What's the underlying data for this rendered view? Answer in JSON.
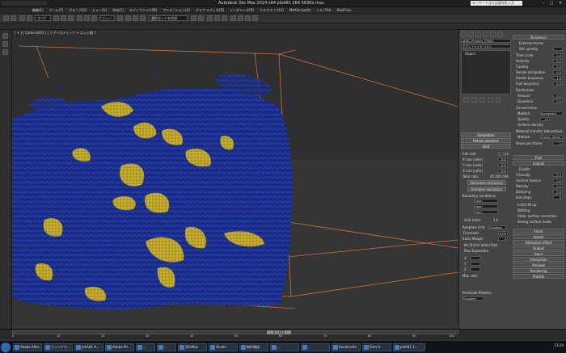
{
  "app": {
    "title": "Autodesk 3ds Max 2014 x64    pikA81 264 5836x.max",
    "search_placeholder": "キーワードまたは語句を入力",
    "window_buttons": [
      "–",
      "□",
      "✕"
    ]
  },
  "menu": [
    "編集(E)",
    "ツール(T)",
    "グループ(G)",
    "ビュー(V)",
    "作成(C)",
    "モディファイヤ(M)",
    "アニメーション(A)",
    "グラフ エディタ(D)",
    "レンダリング(R)",
    "カスタマイズ(U)",
    "MAXScript(X)",
    "ヘルプ(H)",
    "RealFlow"
  ],
  "toolbar": {
    "selection_filter": "すべて",
    "view_dropdown": "ビュー",
    "named_selection": "選択セットを作成"
  },
  "viewport": {
    "label": "[ + ] [ Camera001 ] [ リアリスティック + エッジ面 ]"
  },
  "right_panel": {
    "object_name": "aDSL_Phoenix_FD001",
    "modifier_list": "モディファイヤ リスト",
    "stack_item": "Object",
    "rollouts_left": {
      "simulation": "Simulation",
      "preset_solutions": "Preset solutions",
      "grid": "Grid",
      "cell_size_label": "Cell size",
      "cell_size": "0.0095",
      "size_x_label": "X size (cells)",
      "size_x": "300",
      "size_y_label": "Y size (cells)",
      "size_y": "300",
      "size_z_label": "Z size (cells)",
      "size_z": "500",
      "total_cells_label": "Total cells",
      "total_cells": "45 000 000",
      "decrease_res": "Decrease resolution",
      "increase_res": "Increase resolution",
      "boundary_conditions": "Boundary conditions",
      "bx": "Open",
      "by": "Open",
      "bz": "Open",
      "grid_units_label": "Grid Units:",
      "grid_units": "1.0",
      "adaptive_grid_label": "Adaptive Grid",
      "adaptive_grid": "Disabled",
      "threshold_label": "Threshold",
      "threshold": "0.02",
      "extra_margin_label": "Extra Margin",
      "extra_margin": "0",
      "no_shrink": "No Shrink Initial Size",
      "max_expansion": "Max Expansion",
      "max_x": "X",
      "max_y": "Y",
      "max_z": "Z",
      "limits_label": "Max cells",
      "predicate": "Predicate Phoenix",
      "disabled": "Disabled"
    },
    "rollouts_right": {
      "dynamics": "Dynamics",
      "external_forces": "External forces",
      "gravity": "Std. gravity",
      "time_scale_label": "Time scale",
      "time_scale": "1.0",
      "vorticity_label": "Vorticity",
      "vorticity": "0.0",
      "cooling_label": "Cooling",
      "cooling": "0.0",
      "smoke_dissipation_label": "Smoke dissipation",
      "smoke_dissipation": "0.0",
      "smoke_buoyancy_label": "Smoke buoyancy",
      "smoke_buoyancy": "1.0",
      "fuel_buoyancy_label": "Fuel buoyancy",
      "fuel_buoyancy": "0.0",
      "randomize": "Randomize",
      "amount_label": "Amount",
      "amount": "0.0",
      "dynamics2_label": "Dynamics",
      "dynamics2": "0.0",
      "conservation": "Conservation",
      "method_label": "Method",
      "method": "Symmetric",
      "quality_label": "Quality",
      "quality": "10",
      "uniform_density": "Uniform density",
      "material_transfer": "Material transfer (Advection)",
      "method2_label": "Method",
      "method2": "Classic (Semi",
      "steps_label": "Steps per frame",
      "steps": "1",
      "fuel": "Fuel",
      "liquids": "Liquids",
      "enable": "Enable",
      "viscosity_label": "Viscosity",
      "viscosity": "0.0",
      "surface_tension_label": "Surface tension",
      "surface_tension": "0.0",
      "wet_label": "Wet/dry",
      "wet": "0.0",
      "damp_label": "Damping",
      "damp": "0.0",
      "sim_steps_label": "Sim.steps",
      "sim_steps": "0",
      "initial_fill_up": "Initial fill up",
      "wetting": "Wetting",
      "static_surface": "Static surface correction",
      "strong_surface": "Strong surface mode",
      "foam": "Foam",
      "splash": "Splash",
      "attraction": "Attraction effect",
      "output": "Output",
      "input": "Input",
      "interaction": "Interaction",
      "preview": "Preview",
      "rendering": "Rendering",
      "presets": "Presets"
    }
  },
  "timeline": {
    "slider": "0 / 100",
    "ticks": [
      "0",
      "10",
      "20",
      "30",
      "40",
      "50",
      "60",
      "70",
      "80",
      "90",
      "100"
    ]
  },
  "taskbar": {
    "items": [
      "Adobe After...",
      "ウィンドウ...",
      "pikA81 9...",
      "Adobe Ph...",
      "...",
      "...",
      "3DsMax",
      "Studio",
      "物件確認",
      "...",
      "...",
      "Sandcastle",
      "Sims Ir",
      "pikA81 2..."
    ],
    "clock": "13:24"
  },
  "colors": {
    "liquid_blue": "#1a2e8c",
    "liquid_gold": "#c9b030",
    "grid_orange": "#d0703a"
  }
}
